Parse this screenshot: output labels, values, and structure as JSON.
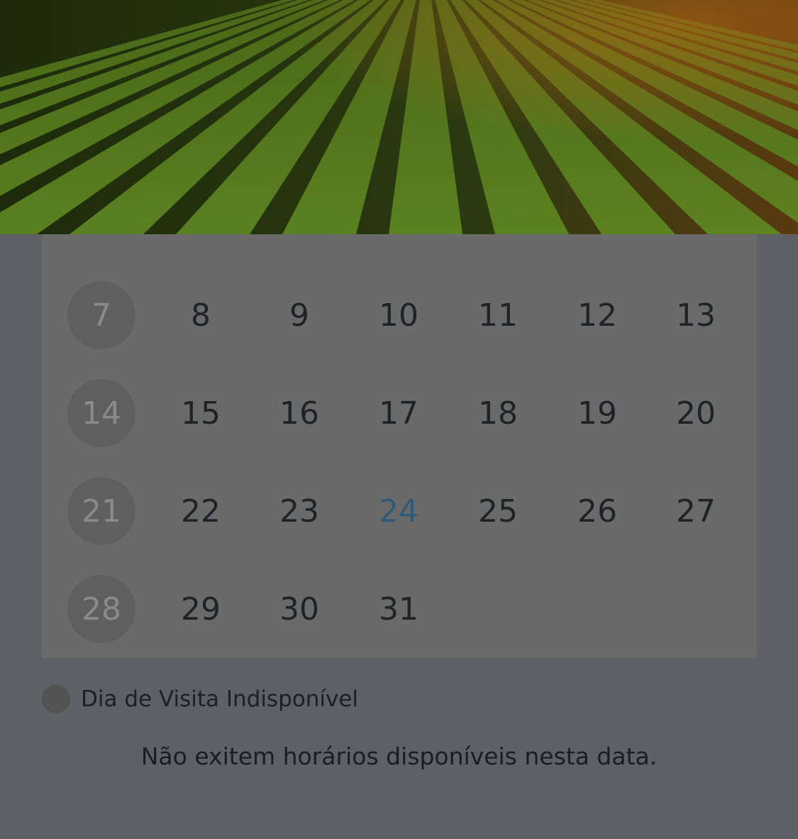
{
  "calendar": {
    "weeks": [
      [
        {
          "day": "7",
          "status": "unavailable"
        },
        {
          "day": "8",
          "status": "available"
        },
        {
          "day": "9",
          "status": "available"
        },
        {
          "day": "10",
          "status": "available"
        },
        {
          "day": "11",
          "status": "available"
        },
        {
          "day": "12",
          "status": "available"
        },
        {
          "day": "13",
          "status": "available"
        }
      ],
      [
        {
          "day": "14",
          "status": "unavailable"
        },
        {
          "day": "15",
          "status": "available"
        },
        {
          "day": "16",
          "status": "available"
        },
        {
          "day": "17",
          "status": "available"
        },
        {
          "day": "18",
          "status": "available"
        },
        {
          "day": "19",
          "status": "available"
        },
        {
          "day": "20",
          "status": "available"
        }
      ],
      [
        {
          "day": "21",
          "status": "unavailable"
        },
        {
          "day": "22",
          "status": "available"
        },
        {
          "day": "23",
          "status": "available"
        },
        {
          "day": "24",
          "status": "today"
        },
        {
          "day": "25",
          "status": "available"
        },
        {
          "day": "26",
          "status": "available"
        },
        {
          "day": "27",
          "status": "available"
        }
      ],
      [
        {
          "day": "28",
          "status": "unavailable"
        },
        {
          "day": "29",
          "status": "available"
        },
        {
          "day": "30",
          "status": "available"
        },
        {
          "day": "31",
          "status": "available"
        }
      ]
    ]
  },
  "legend": {
    "label": "Dia de Visita Indisponível"
  },
  "message": "Não exitem horários disponíveis nesta data.",
  "colors": {
    "background": "#5f6065",
    "calendar_panel": "#6a6a6a",
    "unavailable_circle": "#5f5f5f",
    "today_text": "#2e5a78"
  },
  "hero": {
    "icon": "crop-field-photo"
  }
}
